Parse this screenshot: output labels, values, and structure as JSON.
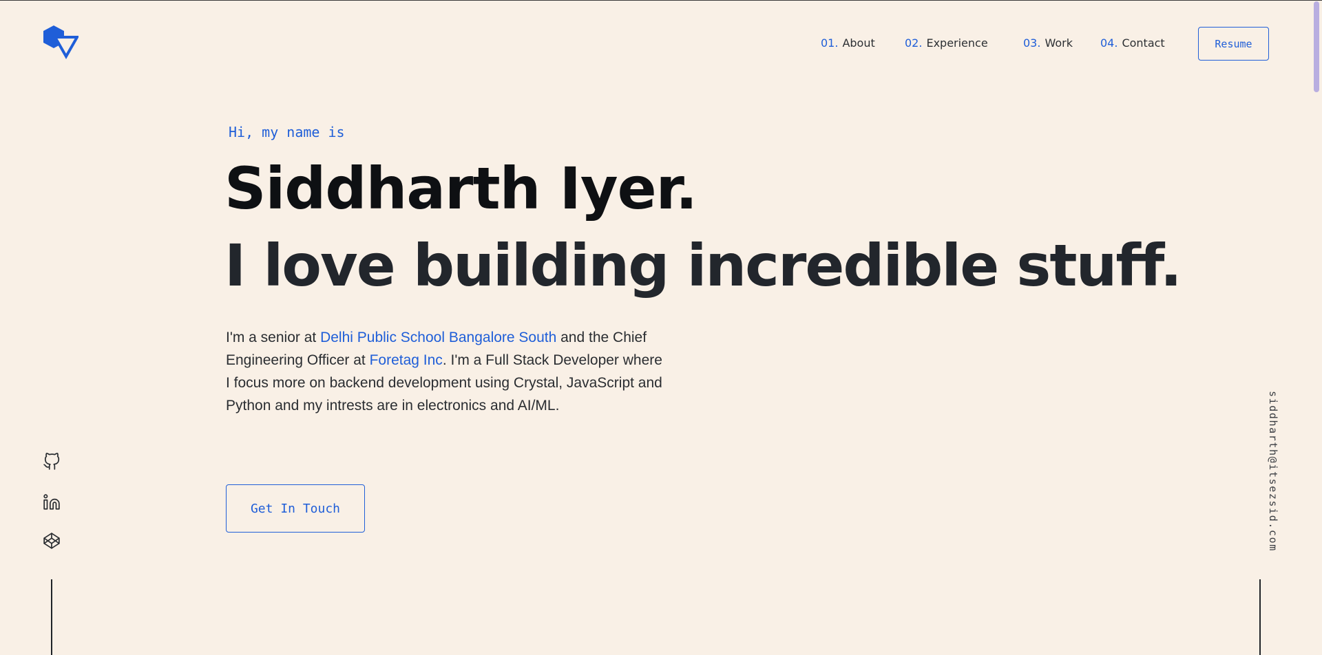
{
  "colors": {
    "background": "#f9f0e6",
    "accent": "#1f5ed8",
    "text_dark": "#0e1013",
    "scroll_thumb": "#b9aee0"
  },
  "logo": {
    "icon": "hexagon-triangle-logo-icon"
  },
  "nav": {
    "items": [
      {
        "num": "01.",
        "label": "About"
      },
      {
        "num": "02.",
        "label": "Experience"
      },
      {
        "num": "03.",
        "label": "Work"
      },
      {
        "num": "04.",
        "label": "Contact"
      }
    ],
    "resume_label": "Resume"
  },
  "hero": {
    "greeting": "Hi, my name is",
    "name": "Siddharth Iyer.",
    "tagline": "I love building incredible stuff.",
    "bio": {
      "p1": "I'm a senior at ",
      "link1": "Delhi Public School Bangalore South",
      "p2": " and the Chief Engineering Officer at ",
      "link2": "Foretag Inc",
      "p3": ". I'm a Full Stack Developer where I focus more on backend development using Crystal, JavaScript and Python and my intrests are in electronics and AI/ML."
    },
    "cta_label": "Get In Touch"
  },
  "social": {
    "icons": [
      "github-icon",
      "linkedin-icon",
      "codepen-icon"
    ]
  },
  "email": "siddharth@itsezsid.com"
}
